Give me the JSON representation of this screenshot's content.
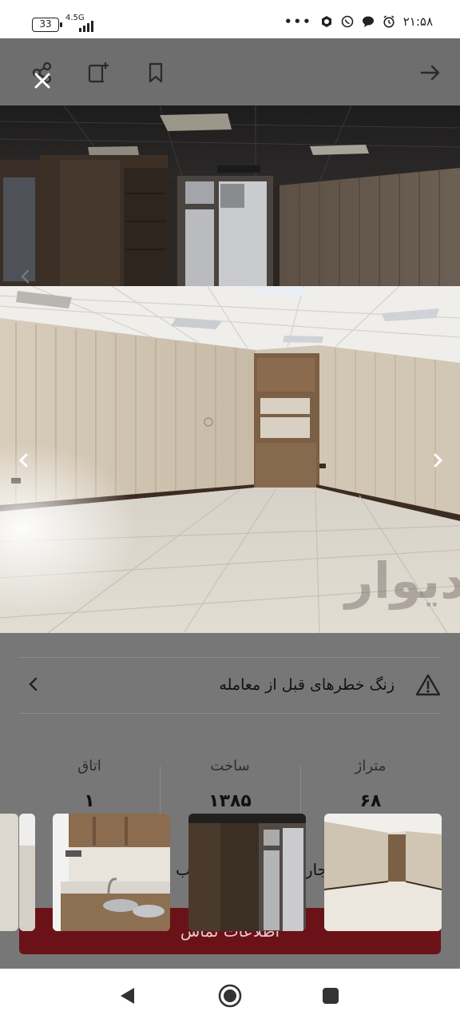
{
  "status_bar": {
    "battery": "33",
    "network": "4.5G",
    "time": "۲۱:۵۸",
    "more": "•••"
  },
  "toolbar": {
    "share_icon": "share-icon",
    "close_icon": "close-icon",
    "note_icon": "add-note-icon",
    "bookmark_icon": "bookmark-icon",
    "back_icon": "arrow-right-icon"
  },
  "watermark": "دیوار",
  "risk": {
    "text": "زنگ خطرهای قبل از معامله"
  },
  "stats": [
    {
      "label": "متراژ",
      "value": "۶۸"
    },
    {
      "label": "ساخت",
      "value": "۱۳۸۵"
    },
    {
      "label": "اتاق",
      "value": "۱"
    }
  ],
  "partial": {
    "left_fragment": "جار",
    "right_fragment": "تب"
  },
  "cta": {
    "label": "اطلاعات تماس"
  },
  "colors": {
    "cta": "#a31c24",
    "overlay": "#000000"
  }
}
